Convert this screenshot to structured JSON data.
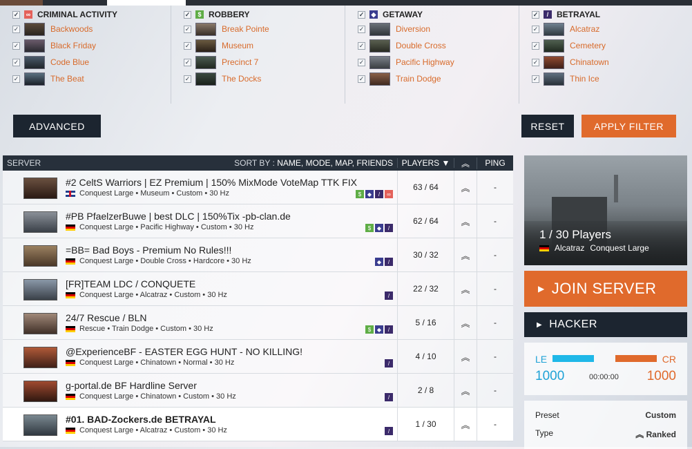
{
  "filters": {
    "groups": [
      {
        "name": "CRIMINAL ACTIVITY",
        "icon": "handcuffs-icon",
        "color": "#e4615a",
        "glyph": "∞",
        "maps": [
          {
            "name": "Backwoods"
          },
          {
            "name": "Black Friday"
          },
          {
            "name": "Code Blue"
          },
          {
            "name": "The Beat"
          }
        ]
      },
      {
        "name": "ROBBERY",
        "icon": "dollar-icon",
        "color": "#5fad46",
        "glyph": "$",
        "maps": [
          {
            "name": "Break Pointe"
          },
          {
            "name": "Museum"
          },
          {
            "name": "Precinct 7"
          },
          {
            "name": "The Docks"
          }
        ]
      },
      {
        "name": "GETAWAY",
        "icon": "car-icon",
        "color": "#3a3d8f",
        "glyph": "◆",
        "maps": [
          {
            "name": "Diversion"
          },
          {
            "name": "Double Cross"
          },
          {
            "name": "Pacific Highway"
          },
          {
            "name": "Train Dodge"
          }
        ]
      },
      {
        "name": "BETRAYAL",
        "icon": "knife-icon",
        "color": "#3b2a6a",
        "glyph": "/",
        "maps": [
          {
            "name": "Alcatraz"
          },
          {
            "name": "Cemetery"
          },
          {
            "name": "Chinatown"
          },
          {
            "name": "Thin Ice"
          }
        ]
      }
    ],
    "advanced_label": "ADVANCED",
    "reset_label": "RESET",
    "apply_label": "APPLY FILTER"
  },
  "list": {
    "header": {
      "server": "SERVER",
      "sort_prefix": "SORT BY :",
      "sort_options": "NAME, MODE, MAP, FRIENDS",
      "players": "PLAYERS ▼",
      "ping": "PING"
    },
    "rows": [
      {
        "name": "#2 CeltS Warriors | EZ Premium | 150% MixMode VoteMap TTK FIX",
        "flag": "uk",
        "info": "Conquest Large • Museum • Custom • 30 Hz",
        "players": "63 / 64",
        "ping": "-",
        "modes": [
          "rb",
          "ga",
          "be",
          "ca"
        ]
      },
      {
        "name": "#PB PfaelzerBuwe | best DLC | 150%Tix -pb-clan.de",
        "flag": "de",
        "info": "Conquest Large • Pacific Highway • Custom • 30 Hz",
        "players": "62 / 64",
        "ping": "-",
        "modes": [
          "rb",
          "ga",
          "be"
        ]
      },
      {
        "name": "=BB= Bad Boys - Premium No Rules!!!",
        "flag": "de",
        "info": "Conquest Large • Double Cross • Hardcore • 30 Hz",
        "players": "30 / 32",
        "ping": "-",
        "modes": [
          "ga",
          "be"
        ]
      },
      {
        "name": "[FR]TEAM LDC / CONQUETE",
        "flag": "de",
        "info": "Conquest Large • Alcatraz • Custom • 30 Hz",
        "players": "22 / 32",
        "ping": "-",
        "modes": [
          "be"
        ]
      },
      {
        "name": "24/7 Rescue / BLN",
        "flag": "de",
        "info": "Rescue • Train Dodge • Custom • 30 Hz",
        "players": "5 / 16",
        "ping": "-",
        "modes": [
          "rb",
          "ga",
          "be"
        ]
      },
      {
        "name": "@ExperienceBF - EASTER EGG HUNT - NO KILLING!",
        "flag": "de",
        "info": "Conquest Large • Chinatown • Normal • 30 Hz",
        "players": "4 / 10",
        "ping": "-",
        "modes": [
          "be"
        ]
      },
      {
        "name": "g-portal.de BF Hardline Server",
        "flag": "de",
        "info": "Conquest Large • Chinatown • Custom • 30 Hz",
        "players": "2 / 8",
        "ping": "-",
        "modes": [
          "be"
        ]
      },
      {
        "name": "#01. BAD-Zockers.de BETRAYAL",
        "flag": "de",
        "info": "Conquest Large • Alcatraz • Custom • 30 Hz",
        "players": "1 / 30",
        "ping": "-",
        "modes": [
          "be"
        ]
      }
    ]
  },
  "side": {
    "players": "1 / 30 Players",
    "map": "Alcatraz",
    "mode": "Conquest Large",
    "join_label": "JOIN SERVER",
    "hacker_label": "HACKER",
    "score": {
      "left_label": "LE",
      "right_label": "CR",
      "left_value": "1000",
      "right_value": "1000",
      "time": "00:00:00"
    },
    "details": [
      {
        "label": "Preset",
        "value": "Custom"
      },
      {
        "label": "Type",
        "value": "Ranked"
      }
    ]
  },
  "colors": {
    "accent": "#e06a2c",
    "dark": "#1c2530",
    "link": "#d86a2a",
    "le": "#1fa2d6"
  }
}
